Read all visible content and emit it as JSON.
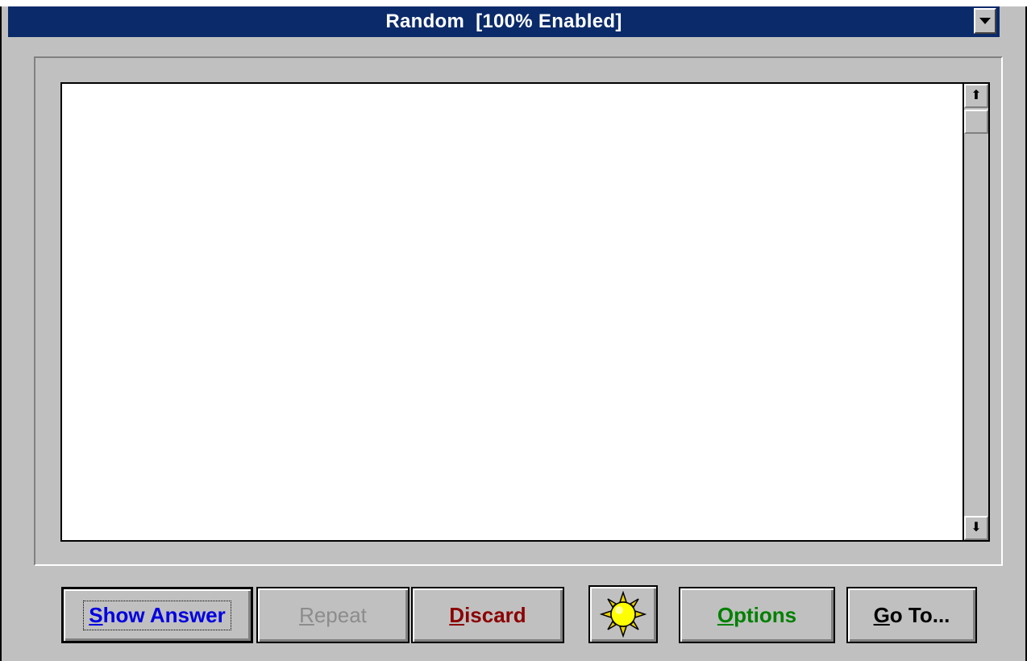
{
  "window": {
    "title": "Random  [100% Enabled]"
  },
  "scrollbar": {
    "up_arrow": "⬆",
    "down_arrow": "⬇"
  },
  "buttons": {
    "show_answer": {
      "mnemonic": "S",
      "rest": "how Answer",
      "color": "#0000e0"
    },
    "repeat": {
      "mnemonic": "R",
      "rest": "epeat",
      "color": "#8c8c8c"
    },
    "discard": {
      "mnemonic": "D",
      "rest": "iscard",
      "color": "#8b0000"
    },
    "sun_icon": "sun-icon",
    "options": {
      "mnemonic": "O",
      "rest": "ptions",
      "color": "#008000"
    },
    "goto": {
      "mnemonic": "G",
      "rest": "o To...",
      "color": "#000000"
    }
  }
}
